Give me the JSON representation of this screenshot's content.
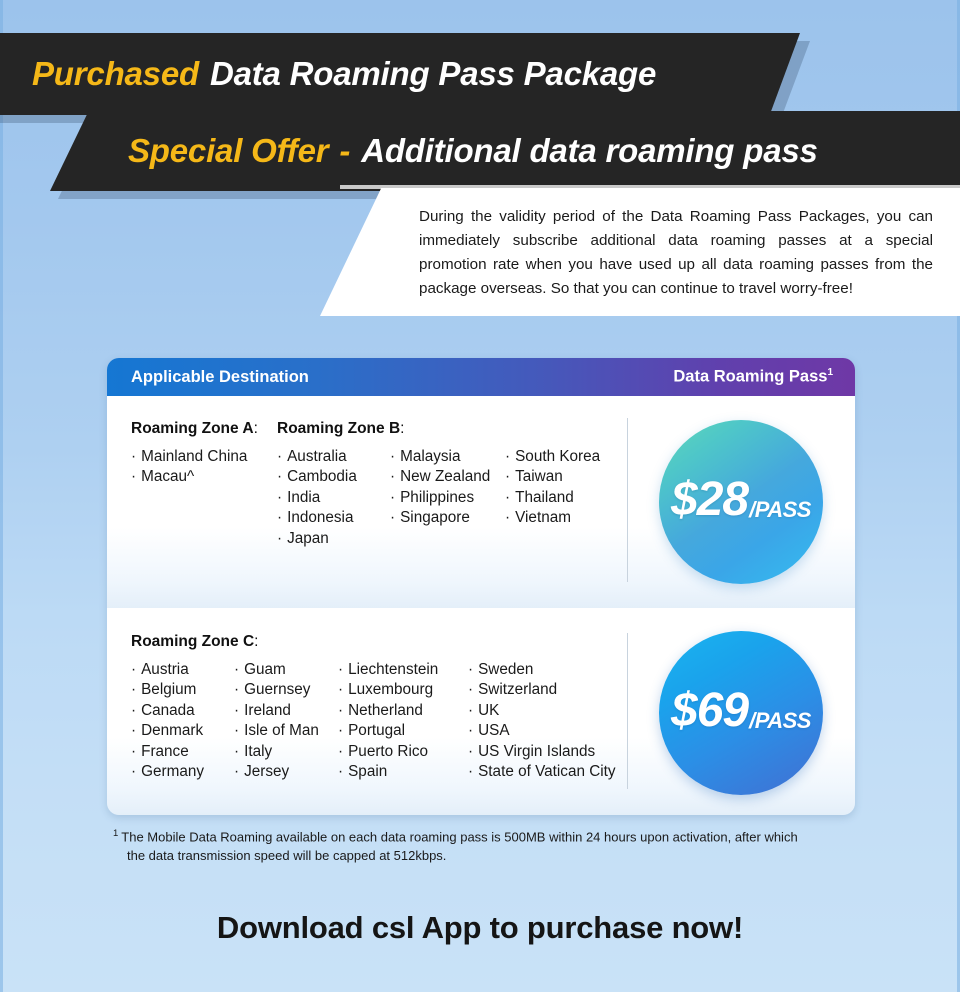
{
  "header": {
    "banner_one": {
      "highlight": "Purchased",
      "rest": "Data Roaming Pass Package"
    },
    "banner_two": {
      "highlight": "Special Offer",
      "dash": "-",
      "rest": "Additional data roaming pass"
    }
  },
  "intro": {
    "text": "During the validity period of the Data Roaming Pass Packages, you can immediately subscribe additional data roaming passes at a special promotion rate when you have used up all data roaming passes from the package overseas. So that you can continue to travel worry-free!"
  },
  "card": {
    "header": {
      "destination_label": "Applicable Destination",
      "pass_label": "Data Roaming Pass",
      "pass_superscript": "1"
    },
    "rows": [
      {
        "zone_a": {
          "title": "Roaming Zone A",
          "colon": ":",
          "countries": [
            "Mainland China",
            "Macau^"
          ]
        },
        "zone_b": {
          "title": "Roaming Zone B",
          "colon": ":",
          "columns": [
            [
              "Australia",
              "Cambodia",
              "India",
              "Indonesia",
              "Japan"
            ],
            [
              "Malaysia",
              "New Zealand",
              "Philippines",
              "Singapore"
            ],
            [
              "South Korea",
              "Taiwan",
              "Thailand",
              "Vietnam"
            ]
          ]
        },
        "price": {
          "amount": "$28",
          "unit": "/PASS"
        }
      },
      {
        "zone_c": {
          "title": "Roaming Zone C",
          "colon": ":",
          "columns": [
            [
              "Austria",
              "Belgium",
              "Canada",
              "Denmark",
              "France",
              "Germany"
            ],
            [
              "Guam",
              "Guernsey",
              "Ireland",
              "Isle of Man",
              "Italy",
              "Jersey"
            ],
            [
              "Liechtenstein",
              "Luxembourg",
              "Netherland",
              "Portugal",
              "Puerto Rico",
              "Spain"
            ],
            [
              "Sweden",
              "Switzerland",
              "UK",
              "USA",
              "US Virgin Islands",
              "State of Vatican City"
            ]
          ]
        },
        "price": {
          "amount": "$69",
          "unit": "/PASS"
        }
      }
    ]
  },
  "footnote": {
    "superscript": "1",
    "line1": "The Mobile Data Roaming available on each data roaming pass is 500MB within 24 hours upon activation, after which",
    "line2": "the data transmission speed will be capped at 512kbps."
  },
  "cta": {
    "text": "Download csl App to purchase now!"
  },
  "bullet": "·",
  "colors": {
    "accent_yellow": "#f5b818",
    "banner_dark": "#252525",
    "header_gradient_start": "#1577d3",
    "header_gradient_end": "#6f38a6",
    "bubble_28_start": "#5fd9b8",
    "bubble_28_end": "#35bdf0",
    "bubble_69_start": "#19b5ef",
    "bubble_69_end": "#4570d2",
    "page_background_top": "#9cc3ec",
    "page_background_bottom": "#c9e2f7"
  }
}
